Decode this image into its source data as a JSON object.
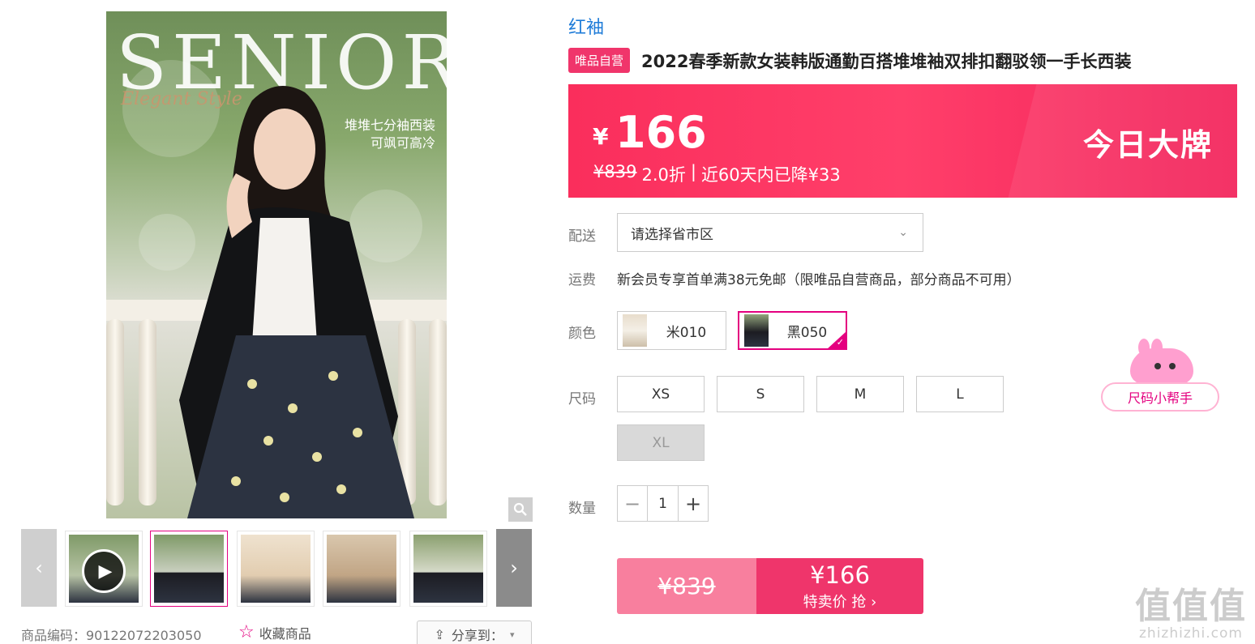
{
  "gallery": {
    "main_image": {
      "overlay_title": "SENIOR",
      "overlay_script": "Elegant Style",
      "caption_lines": [
        "堆堆七分袖西装",
        "可飒可高冷"
      ]
    },
    "thumbnails": [
      {
        "label": "SENIOR"
      },
      {
        "label": "SENIOR"
      },
      {
        "label": ""
      },
      {
        "label": ""
      },
      {
        "label": ""
      }
    ],
    "zoom_icon": "magnifier-icon"
  },
  "meta": {
    "item_code": "商品编码：90122072203050",
    "favorite_label": "收藏商品",
    "share_label": "分享到："
  },
  "product": {
    "brand": "红袖",
    "badge": "唯品自营",
    "title": "2022春季新款女装韩版通勤百搭堆堆袖双排扣翻驳领一手长西装"
  },
  "price": {
    "currency": "¥",
    "value": "166",
    "original": "¥839",
    "discount": "2.0折",
    "separator": "|",
    "drop_note": "近60天内已降¥33",
    "promo": "今日大牌"
  },
  "delivery": {
    "label": "配送",
    "placeholder": "请选择省市区"
  },
  "freight": {
    "label": "运费",
    "text": "新会员专享首单满38元免邮（限唯品自营商品，部分商品不可用）"
  },
  "color": {
    "label": "颜色",
    "options": [
      {
        "name": "米010",
        "selected": false
      },
      {
        "name": "黑050",
        "selected": true
      }
    ]
  },
  "size": {
    "label": "尺码",
    "options": [
      {
        "name": "XS",
        "disabled": false
      },
      {
        "name": "S",
        "disabled": false
      },
      {
        "name": "M",
        "disabled": false
      },
      {
        "name": "L",
        "disabled": false
      },
      {
        "name": "XL",
        "disabled": true
      }
    ],
    "helper": "尺码小帮手"
  },
  "quantity": {
    "label": "数量",
    "value": "1",
    "minus": "−",
    "plus": "+"
  },
  "buy": {
    "original": "¥839",
    "price": "¥166",
    "action": "特卖价 抢 ›"
  },
  "watermark": {
    "main": "值值值",
    "domain": "zhizhizhi.com"
  },
  "colors": {
    "accent": "#e4007f",
    "banner": "#fa2e5c",
    "brand_link": "#1e7bd8"
  }
}
